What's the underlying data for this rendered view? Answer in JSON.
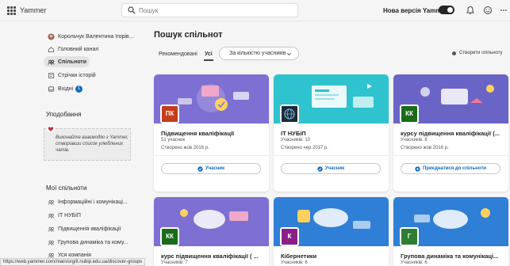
{
  "app": {
    "title": "Yammer"
  },
  "search": {
    "placeholder": "Пошук"
  },
  "header": {
    "new_version_label": "Нова версія Yammer"
  },
  "sidebar": {
    "user": "Корольчук Валентина Ігорів...",
    "items": [
      {
        "label": "Головний канал"
      },
      {
        "label": "Спільноти"
      },
      {
        "label": "Стрічки історій"
      },
      {
        "label": "Вхідні",
        "badge": "1"
      }
    ],
    "favorites_title": "Уподобання",
    "favorites_hint": "Виконайте взаємодію з Yammer, створивши список улюблених чатів.",
    "my_communities_title": "Мої спільноти",
    "communities": [
      {
        "label": "Інформаційні і комунікаці..."
      },
      {
        "label": "ІТ НУБіП"
      },
      {
        "label": "Підвищення кваліфікації"
      },
      {
        "label": "Групова динаміка та кому..."
      },
      {
        "label": "Уся компанія"
      }
    ]
  },
  "main": {
    "title": "Пошук спільнот",
    "tabs": [
      {
        "label": "Рекомендовані"
      },
      {
        "label": "Усі"
      }
    ],
    "sort_label": "За кількістю учасників",
    "create_label": "Створити спільноту"
  },
  "cards": [
    {
      "initials": "ПК",
      "avatar_color": "#c43e1c",
      "banner_color": "#7e6fd3",
      "name": "Підвищення кваліфікації",
      "members": "51 учасник",
      "created": "Створено жов 2016 р.",
      "button": "Учасник"
    },
    {
      "initials": "",
      "avatar_color": "#1b2a3a",
      "banner_color": "#2fc3cf",
      "name": "ІТ НУБіП",
      "members": "Учасників: 10",
      "created": "Створено чер 2017 р.",
      "button": "Учасник"
    },
    {
      "initials": "КК",
      "avatar_color": "#1a6b1a",
      "banner_color": "#6b64c7",
      "name": "курсу підвищення кваліфікації (...",
      "members": "Учасників: 8",
      "created": "Створено жов 2016 р.",
      "button": "Приєднатися до спільноти"
    },
    {
      "initials": "КК",
      "avatar_color": "#1a6b1a",
      "banner_color": "#7e6fd3",
      "name": "курс підвищення кваліфікації ( ...",
      "members": "Учасників: 7",
      "created": "",
      "button": ""
    },
    {
      "initials": "К",
      "avatar_color": "#8a1f8a",
      "banner_color": "#2f7fd6",
      "name": "Кібернетики",
      "members": "Учасників: 6",
      "created": "",
      "button": ""
    },
    {
      "initials": "Г",
      "avatar_color": "#2e7d32",
      "banner_color": "#2f7fd6",
      "name": "Групова динаміка та комунікаці...",
      "members": "Учасників: 6",
      "created": "",
      "button": ""
    }
  ],
  "status": {
    "url": "https://web.yammer.com/main/org/it.nubip.edu.ua/discover-groups"
  }
}
